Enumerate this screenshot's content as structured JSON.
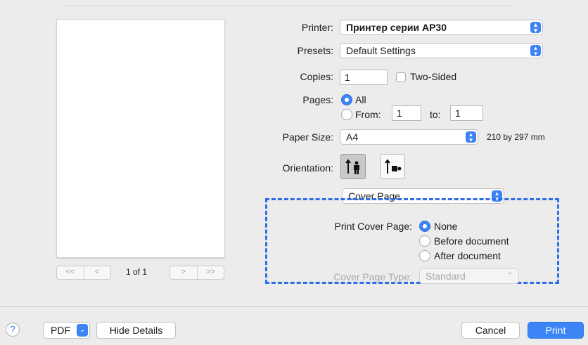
{
  "preview": {
    "page_indicator": "1 of 1",
    "first": "<<",
    "prev": "<",
    "next": ">",
    "last": ">>"
  },
  "printer": {
    "label": "Printer:",
    "value": "Принтер серии AP30"
  },
  "presets": {
    "label": "Presets:",
    "value": "Default Settings"
  },
  "copies": {
    "label": "Copies:",
    "value": "1",
    "two_sided_label": "Two-Sided"
  },
  "pages": {
    "label": "Pages:",
    "all_label": "All",
    "from_label": "From:",
    "from_value": "1",
    "to_label": "to:",
    "to_value": "1"
  },
  "paper_size": {
    "label": "Paper Size:",
    "value": "A4",
    "dimensions": "210 by 297 mm"
  },
  "orientation": {
    "label": "Orientation:"
  },
  "section": {
    "value": "Cover Page"
  },
  "cover_page": {
    "label": "Print Cover Page:",
    "options": [
      "None",
      "Before document",
      "After document"
    ],
    "type_label": "Cover Page Type:",
    "type_value": "Standard"
  },
  "footer": {
    "help": "?",
    "pdf_label": "PDF",
    "hide_details": "Hide Details",
    "cancel": "Cancel",
    "print": "Print"
  },
  "colors": {
    "accent": "#3b85f7",
    "highlight_dash": "#2f6ee6"
  }
}
